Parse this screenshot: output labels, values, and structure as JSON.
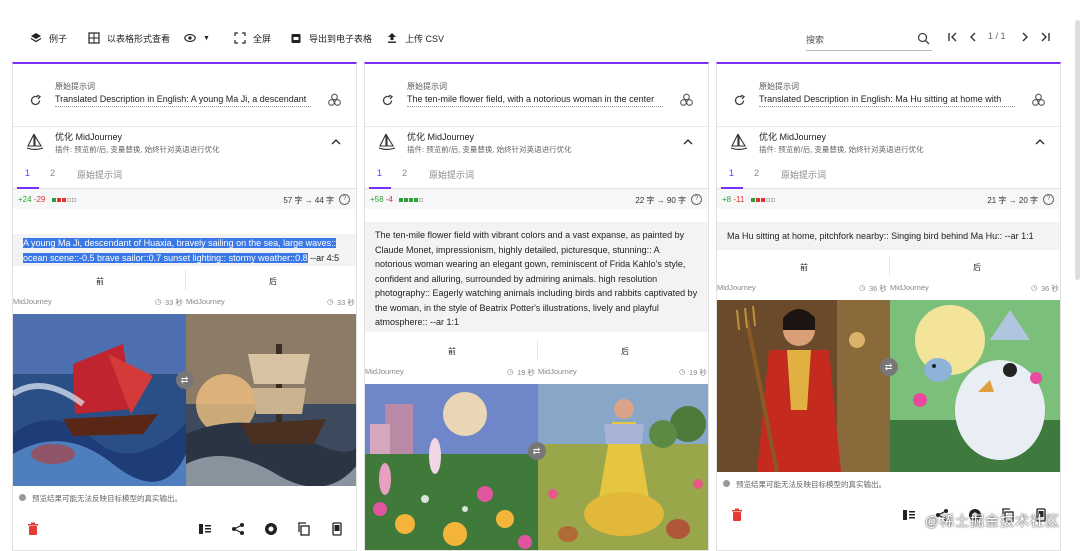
{
  "toolbar": {
    "examples": "例子",
    "table_view": "以表格形式查看",
    "fullscreen": "全屏",
    "export": "导出到电子表格",
    "upload": "上传 CSV",
    "search_placeholder": "搜索",
    "page_info": "1 / 1"
  },
  "common": {
    "original_prompt_label": "原始提示词",
    "optimize_title": "优化 MidJourney",
    "optimize_desc": "插件: 预览前/后, 变量替换, 始终针对英语进行优化",
    "tab1": "1",
    "tab2": "2",
    "tab3": "原始提示词",
    "before": "前",
    "after": "后",
    "engine": "MidJourney",
    "note": "预览结果可能无法反映目标模型的真实输出。",
    "accent": "#7b2ff7"
  },
  "cards": [
    {
      "prompt": "Translated Description in English: A young Ma Ji, a descendant",
      "plus": "+24",
      "minus": "-29",
      "count": "57 字 → 44 字",
      "output_selected": "A young Ma Ji, descendant of Huaxia, bravely sailing on the sea, large waves:: ocean scene::-0.5 brave sailor::0.7 sunset lighting:: stormy weather::0.8",
      "output_rest": " --ar 4:5",
      "time_before": "33 秒",
      "time_after": "33 秒"
    },
    {
      "prompt": "The ten-mile flower field, with a notorious woman in the center",
      "plus": "+58",
      "minus": "-4",
      "count": "22 字 → 90 字",
      "output_selected": "",
      "output_rest": "The ten-mile flower field with vibrant colors and a vast expanse, as painted by Claude Monet, impressionism, highly detailed, picturesque, stunning:: A notorious woman wearing an elegant gown, reminiscent of Frida Kahlo's style, confident and alluring, surrounded by admiring animals. high resolution photography:: Eagerly watching animals including birds and rabbits captivated by the woman, in the style of Beatrix Potter's illustrations, lively and playful atmosphere:: --ar 1:1",
      "time_before": "19 秒",
      "time_after": "19 秒"
    },
    {
      "prompt": "Translated Description in English: Ma Hu sitting at home with",
      "plus": "+8",
      "minus": "-11",
      "count": "21 字 → 20 字",
      "output_selected": "",
      "output_rest": "Ma Hu sitting at home, pitchfork nearby:: Singing bird behind Ma Hu:: --ar 1:1",
      "time_before": "36 秒",
      "time_after": "36 秒"
    }
  ],
  "watermark": "@稀土掘金技术社区"
}
